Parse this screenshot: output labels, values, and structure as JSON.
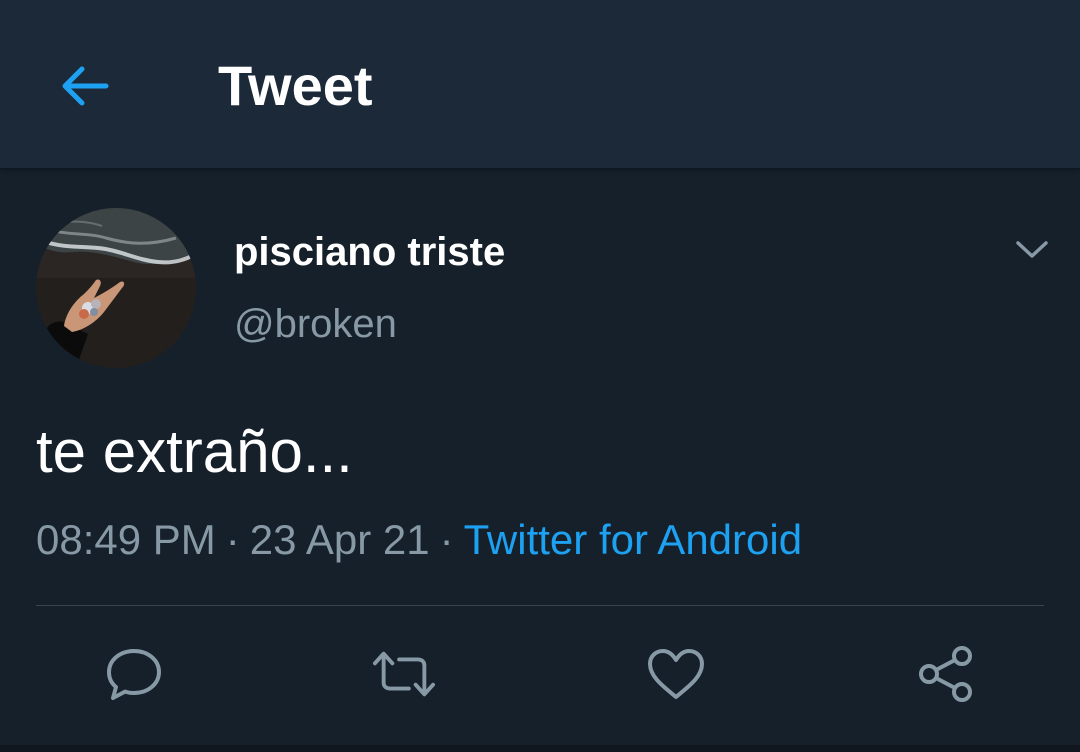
{
  "colors": {
    "background": "#15202b",
    "header_background": "#1c2938",
    "accent": "#1da1f2",
    "secondary_text": "#8899a6",
    "divider": "#38444d"
  },
  "header": {
    "back_icon": "arrow-left-icon",
    "title": "Tweet"
  },
  "tweet": {
    "author": {
      "display_name": "pisciano triste",
      "handle": "@broken"
    },
    "menu_icon": "chevron-down-icon",
    "text": "te extraño...",
    "time": "08:49 PM",
    "separator": "·",
    "date": "23 Apr 21",
    "source": "Twitter for Android",
    "actions": {
      "reply_icon": "reply-icon",
      "retweet_icon": "retweet-icon",
      "like_icon": "heart-icon",
      "share_icon": "share-icon"
    }
  }
}
